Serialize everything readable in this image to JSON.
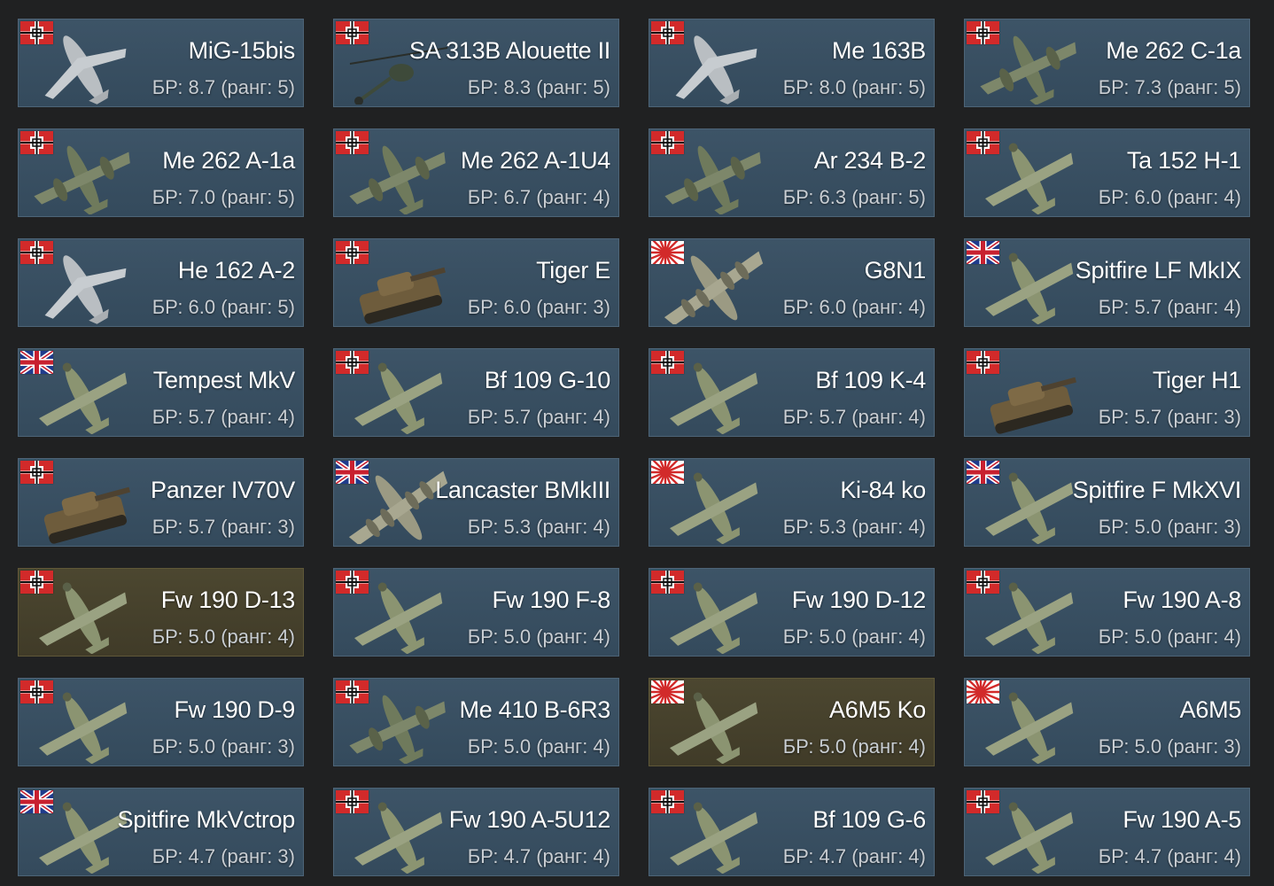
{
  "br_prefix": "БР:",
  "rank_word": "ранг:",
  "colors": {
    "card_bg": "#3a5164",
    "card_highlight_bg": "#48432d",
    "background": "#202122",
    "name_text": "#ffffff",
    "br_text": "#c9ced3"
  },
  "vehicles": [
    {
      "name": "MiG-15bis",
      "br": "8.7",
      "rank": "5",
      "flag": "germany",
      "kind": "jet",
      "highlight": false
    },
    {
      "name": "SA 313B Alouette II",
      "br": "8.3",
      "rank": "5",
      "flag": "germany",
      "kind": "heli",
      "highlight": false
    },
    {
      "name": "Me 163B",
      "br": "8.0",
      "rank": "5",
      "flag": "germany",
      "kind": "jet",
      "highlight": false
    },
    {
      "name": "Me 262 C-1a",
      "br": "7.3",
      "rank": "5",
      "flag": "germany",
      "kind": "twin",
      "highlight": false
    },
    {
      "name": "Me 262 A-1a",
      "br": "7.0",
      "rank": "5",
      "flag": "germany",
      "kind": "twin",
      "highlight": false
    },
    {
      "name": "Me 262 A-1U4",
      "br": "6.7",
      "rank": "4",
      "flag": "germany",
      "kind": "twin",
      "highlight": false
    },
    {
      "name": "Ar 234 B-2",
      "br": "6.3",
      "rank": "5",
      "flag": "germany",
      "kind": "twin",
      "highlight": false
    },
    {
      "name": "Ta 152 H-1",
      "br": "6.0",
      "rank": "4",
      "flag": "germany",
      "kind": "plane",
      "highlight": false
    },
    {
      "name": "He 162 A-2",
      "br": "6.0",
      "rank": "5",
      "flag": "germany",
      "kind": "jet",
      "highlight": false
    },
    {
      "name": "Tiger E",
      "br": "6.0",
      "rank": "3",
      "flag": "germany",
      "kind": "tank",
      "highlight": false
    },
    {
      "name": "G8N1",
      "br": "6.0",
      "rank": "4",
      "flag": "japan",
      "kind": "bomber",
      "highlight": false
    },
    {
      "name": "Spitfire LF MkIX",
      "br": "5.7",
      "rank": "4",
      "flag": "uk",
      "kind": "plane",
      "highlight": false
    },
    {
      "name": "Tempest MkV",
      "br": "5.7",
      "rank": "4",
      "flag": "uk",
      "kind": "plane",
      "highlight": false
    },
    {
      "name": "Bf 109 G-10",
      "br": "5.7",
      "rank": "4",
      "flag": "germany",
      "kind": "plane",
      "highlight": false
    },
    {
      "name": "Bf 109 K-4",
      "br": "5.7",
      "rank": "4",
      "flag": "germany",
      "kind": "plane",
      "highlight": false
    },
    {
      "name": "Tiger H1",
      "br": "5.7",
      "rank": "3",
      "flag": "germany",
      "kind": "tank",
      "highlight": false
    },
    {
      "name": "Panzer IV70V",
      "br": "5.7",
      "rank": "3",
      "flag": "germany",
      "kind": "tank",
      "highlight": false
    },
    {
      "name": "Lancaster BMkIII",
      "br": "5.3",
      "rank": "4",
      "flag": "uk",
      "kind": "bomber",
      "highlight": false
    },
    {
      "name": "Ki-84 ko",
      "br": "5.3",
      "rank": "4",
      "flag": "japan",
      "kind": "plane",
      "highlight": false
    },
    {
      "name": "Spitfire F MkXVI",
      "br": "5.0",
      "rank": "3",
      "flag": "uk",
      "kind": "plane",
      "highlight": false
    },
    {
      "name": "Fw 190 D-13",
      "br": "5.0",
      "rank": "4",
      "flag": "germany",
      "kind": "plane",
      "highlight": true
    },
    {
      "name": "Fw 190 F-8",
      "br": "5.0",
      "rank": "4",
      "flag": "germany",
      "kind": "plane",
      "highlight": false
    },
    {
      "name": "Fw 190 D-12",
      "br": "5.0",
      "rank": "4",
      "flag": "germany",
      "kind": "plane",
      "highlight": false
    },
    {
      "name": "Fw 190 A-8",
      "br": "5.0",
      "rank": "4",
      "flag": "germany",
      "kind": "plane",
      "highlight": false
    },
    {
      "name": "Fw 190 D-9",
      "br": "5.0",
      "rank": "3",
      "flag": "germany",
      "kind": "plane",
      "highlight": false
    },
    {
      "name": "Me 410 B-6R3",
      "br": "5.0",
      "rank": "4",
      "flag": "germany",
      "kind": "twin",
      "highlight": false
    },
    {
      "name": "A6M5 Ko",
      "br": "5.0",
      "rank": "4",
      "flag": "japan",
      "kind": "plane",
      "highlight": true
    },
    {
      "name": "A6M5",
      "br": "5.0",
      "rank": "3",
      "flag": "japan",
      "kind": "plane",
      "highlight": false
    },
    {
      "name": "Spitfire MkVctrop",
      "br": "4.7",
      "rank": "3",
      "flag": "uk",
      "kind": "plane",
      "highlight": false
    },
    {
      "name": "Fw 190 A-5U12",
      "br": "4.7",
      "rank": "4",
      "flag": "germany",
      "kind": "plane",
      "highlight": false
    },
    {
      "name": "Bf 109 G-6",
      "br": "4.7",
      "rank": "4",
      "flag": "germany",
      "kind": "plane",
      "highlight": false
    },
    {
      "name": "Fw 190 A-5",
      "br": "4.7",
      "rank": "4",
      "flag": "germany",
      "kind": "plane",
      "highlight": false
    }
  ]
}
